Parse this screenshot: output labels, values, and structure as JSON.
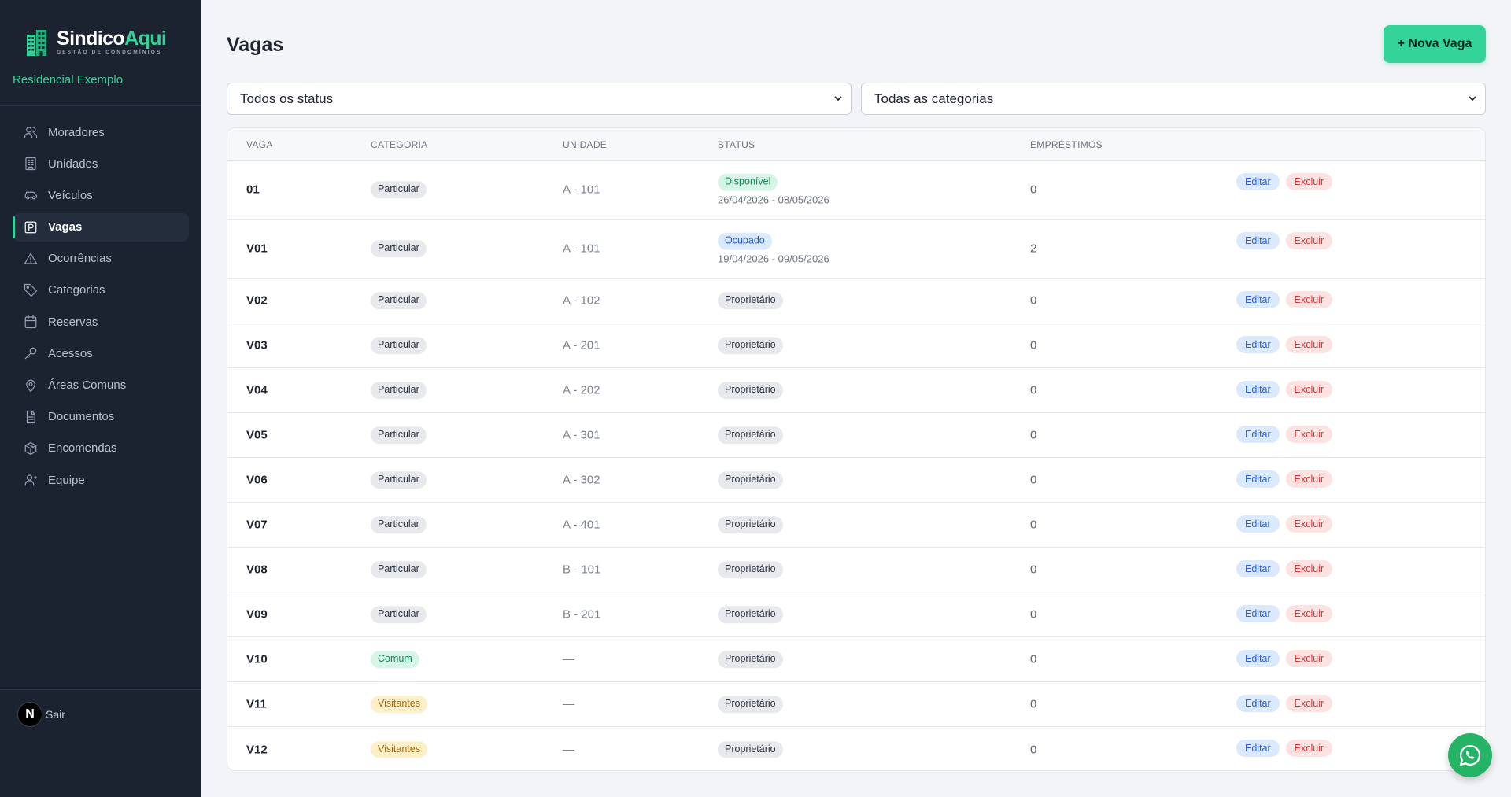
{
  "brand": {
    "name_part1": "Sindico",
    "name_part2": "Aqui",
    "tagline": "GESTÃO DE CONDOMÍNIOS"
  },
  "condo_name": "Residencial Exemplo",
  "nav": [
    {
      "label": "Moradores",
      "icon": "users-icon"
    },
    {
      "label": "Unidades",
      "icon": "building-icon"
    },
    {
      "label": "Veículos",
      "icon": "car-icon"
    },
    {
      "label": "Vagas",
      "icon": "parking-icon",
      "active": true
    },
    {
      "label": "Ocorrências",
      "icon": "alert-triangle-icon"
    },
    {
      "label": "Categorias",
      "icon": "tag-icon"
    },
    {
      "label": "Reservas",
      "icon": "calendar-icon"
    },
    {
      "label": "Acessos",
      "icon": "key-icon"
    },
    {
      "label": "Áreas Comuns",
      "icon": "map-pin-icon"
    },
    {
      "label": "Documentos",
      "icon": "document-icon"
    },
    {
      "label": "Encomendas",
      "icon": "package-icon"
    },
    {
      "label": "Equipe",
      "icon": "team-icon"
    }
  ],
  "logout": {
    "avatar_letter": "N",
    "label": "Sair"
  },
  "page": {
    "title": "Vagas",
    "new_button": "+ Nova Vaga"
  },
  "filters": {
    "status": "Todos os status",
    "category": "Todas as categorias"
  },
  "table": {
    "headers": {
      "vaga": "VAGA",
      "categoria": "CATEGORIA",
      "unidade": "UNIDADE",
      "status": "STATUS",
      "emprestimos": "EMPRÉSTIMOS"
    },
    "edit_label": "Editar",
    "delete_label": "Excluir",
    "rows": [
      {
        "vaga": "01",
        "categoria": "Particular",
        "cat_style": "gray",
        "unidade": "A - 101",
        "status": "Disponível",
        "status_style": "green",
        "dates": "26/04/2026 - 08/05/2026",
        "emprestimos": "0"
      },
      {
        "vaga": "V01",
        "categoria": "Particular",
        "cat_style": "gray",
        "unidade": "A - 101",
        "status": "Ocupado",
        "status_style": "blue",
        "dates": "19/04/2026 - 09/05/2026",
        "emprestimos": "2"
      },
      {
        "vaga": "V02",
        "categoria": "Particular",
        "cat_style": "gray",
        "unidade": "A - 102",
        "status": "Proprietário",
        "status_style": "gray",
        "emprestimos": "0"
      },
      {
        "vaga": "V03",
        "categoria": "Particular",
        "cat_style": "gray",
        "unidade": "A - 201",
        "status": "Proprietário",
        "status_style": "gray",
        "emprestimos": "0"
      },
      {
        "vaga": "V04",
        "categoria": "Particular",
        "cat_style": "gray",
        "unidade": "A - 202",
        "status": "Proprietário",
        "status_style": "gray",
        "emprestimos": "0"
      },
      {
        "vaga": "V05",
        "categoria": "Particular",
        "cat_style": "gray",
        "unidade": "A - 301",
        "status": "Proprietário",
        "status_style": "gray",
        "emprestimos": "0"
      },
      {
        "vaga": "V06",
        "categoria": "Particular",
        "cat_style": "gray",
        "unidade": "A - 302",
        "status": "Proprietário",
        "status_style": "gray",
        "emprestimos": "0"
      },
      {
        "vaga": "V07",
        "categoria": "Particular",
        "cat_style": "gray",
        "unidade": "A - 401",
        "status": "Proprietário",
        "status_style": "gray",
        "emprestimos": "0"
      },
      {
        "vaga": "V08",
        "categoria": "Particular",
        "cat_style": "gray",
        "unidade": "B - 101",
        "status": "Proprietário",
        "status_style": "gray",
        "emprestimos": "0"
      },
      {
        "vaga": "V09",
        "categoria": "Particular",
        "cat_style": "gray",
        "unidade": "B - 201",
        "status": "Proprietário",
        "status_style": "gray",
        "emprestimos": "0"
      },
      {
        "vaga": "V10",
        "categoria": "Comum",
        "cat_style": "green",
        "unidade": "—",
        "status": "Proprietário",
        "status_style": "gray",
        "emprestimos": "0"
      },
      {
        "vaga": "V11",
        "categoria": "Visitantes",
        "cat_style": "yellow",
        "unidade": "—",
        "status": "Proprietário",
        "status_style": "gray",
        "emprestimos": "0"
      },
      {
        "vaga": "V12",
        "categoria": "Visitantes",
        "cat_style": "yellow",
        "unidade": "—",
        "status": "Proprietário",
        "status_style": "gray",
        "emprestimos": "0"
      }
    ]
  },
  "colors": {
    "sidebar_bg": "#1b2330",
    "accent": "#34d399",
    "page_bg": "#f2f4f7"
  },
  "floating": {
    "icon": "whatsapp-icon"
  }
}
